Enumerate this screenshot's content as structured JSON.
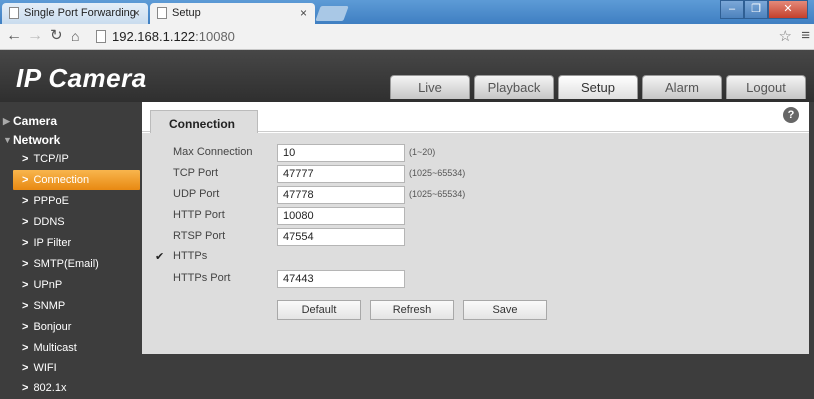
{
  "browser": {
    "tabs": [
      {
        "label": "Single Port Forwarding"
      },
      {
        "label": "Setup"
      }
    ],
    "url_host": "192.168.1.122",
    "url_port": ":10080"
  },
  "app": {
    "logo": "IP Camera",
    "nav_tabs": [
      "Live",
      "Playback",
      "Setup",
      "Alarm",
      "Logout"
    ],
    "active_nav": "Setup"
  },
  "sidebar": {
    "groups": {
      "camera": "Camera",
      "network": "Network"
    },
    "items": [
      "TCP/IP",
      "Connection",
      "PPPoE",
      "DDNS",
      "IP Filter",
      "SMTP(Email)",
      "UPnP",
      "SNMP",
      "Bonjour",
      "Multicast",
      "WIFI",
      "802.1x"
    ],
    "selected": "Connection"
  },
  "content": {
    "tab": "Connection",
    "help": "?",
    "fields": {
      "max_connection": {
        "label": "Max Connection",
        "value": "10",
        "range": "(1~20)"
      },
      "tcp_port": {
        "label": "TCP Port",
        "value": "47777",
        "range": "(1025~65534)"
      },
      "udp_port": {
        "label": "UDP Port",
        "value": "47778",
        "range": "(1025~65534)"
      },
      "http_port": {
        "label": "HTTP Port",
        "value": "10080"
      },
      "rtsp_port": {
        "label": "RTSP Port",
        "value": "47554"
      },
      "https_port": {
        "label": "HTTPs Port",
        "value": "47443"
      }
    },
    "https": {
      "label": "HTTPs",
      "checked": true
    },
    "buttons": {
      "default": "Default",
      "refresh": "Refresh",
      "save": "Save"
    }
  },
  "colors": {
    "accent": "#f0a030",
    "header_bg": "#3a3a3a",
    "panel_bg": "#dddddd"
  }
}
